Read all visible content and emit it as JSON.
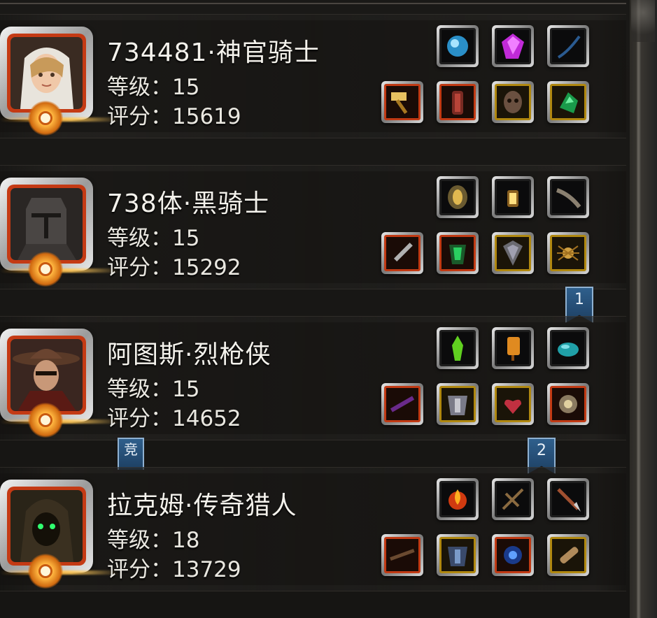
{
  "players": [
    {
      "name": "734481·神官骑士",
      "level_text": "等级：15",
      "score_text": "评分：15619",
      "portrait_icon": "female-priest-portrait-icon",
      "top_slots": [
        {
          "icon": "blue-orb-icon",
          "frame": "gray"
        },
        {
          "icon": "purple-gem-icon",
          "frame": "gray"
        },
        {
          "icon": "dark-feather-icon",
          "frame": "gray"
        }
      ],
      "bottom_slots": [
        {
          "icon": "golden-hammer-icon",
          "frame": "red"
        },
        {
          "icon": "red-armor-icon",
          "frame": "red"
        },
        {
          "icon": "skull-mask-icon",
          "frame": "gold"
        },
        {
          "icon": "green-gem-icon",
          "frame": "gold"
        }
      ]
    },
    {
      "name": "738体·黑骑士",
      "level_text": "等级：15",
      "score_text": "评分：15292",
      "portrait_icon": "black-knight-helmet-portrait-icon",
      "top_slots": [
        {
          "icon": "gold-shield-icon",
          "frame": "gray"
        },
        {
          "icon": "lantern-icon",
          "frame": "gray"
        },
        {
          "icon": "horn-icon",
          "frame": "gray"
        }
      ],
      "bottom_slots": [
        {
          "icon": "greatsword-icon",
          "frame": "red"
        },
        {
          "icon": "green-armor-icon",
          "frame": "red"
        },
        {
          "icon": "kite-shield-icon",
          "frame": "gold"
        },
        {
          "icon": "gold-spider-icon",
          "frame": "gold"
        }
      ]
    },
    {
      "name": "阿图斯·烈枪侠",
      "level_text": "等级：15",
      "score_text": "评分：14652",
      "portrait_icon": "gunslinger-portrait-icon",
      "top_slots": [
        {
          "icon": "green-crystal-icon",
          "frame": "gray"
        },
        {
          "icon": "orange-lantern-icon",
          "frame": "gray"
        },
        {
          "icon": "teal-stone-icon",
          "frame": "gray"
        }
      ],
      "bottom_slots": [
        {
          "icon": "purple-rifle-icon",
          "frame": "red"
        },
        {
          "icon": "steel-armor-icon",
          "frame": "gold"
        },
        {
          "icon": "heart-amulet-icon",
          "frame": "gold"
        },
        {
          "icon": "stone-ring-icon",
          "frame": "red"
        }
      ]
    },
    {
      "name": "拉克姆·传奇猎人",
      "level_text": "等级：18",
      "score_text": "评分：13729",
      "portrait_icon": "hooded-hunter-portrait-icon",
      "top_slots": [
        {
          "icon": "fire-orb-icon",
          "frame": "gray"
        },
        {
          "icon": "wooden-crossbow-icon",
          "frame": "gray"
        },
        {
          "icon": "bolt-arrow-icon",
          "frame": "gray"
        }
      ],
      "bottom_slots": [
        {
          "icon": "musket-icon",
          "frame": "red"
        },
        {
          "icon": "blue-armor-icon",
          "frame": "gold"
        },
        {
          "icon": "blue-rune-amulet-icon",
          "frame": "red"
        },
        {
          "icon": "wooden-bracer-icon",
          "frame": "gold"
        }
      ]
    }
  ],
  "ribbons": {
    "rank1": "1",
    "rank2": "2",
    "arena": "竞"
  }
}
